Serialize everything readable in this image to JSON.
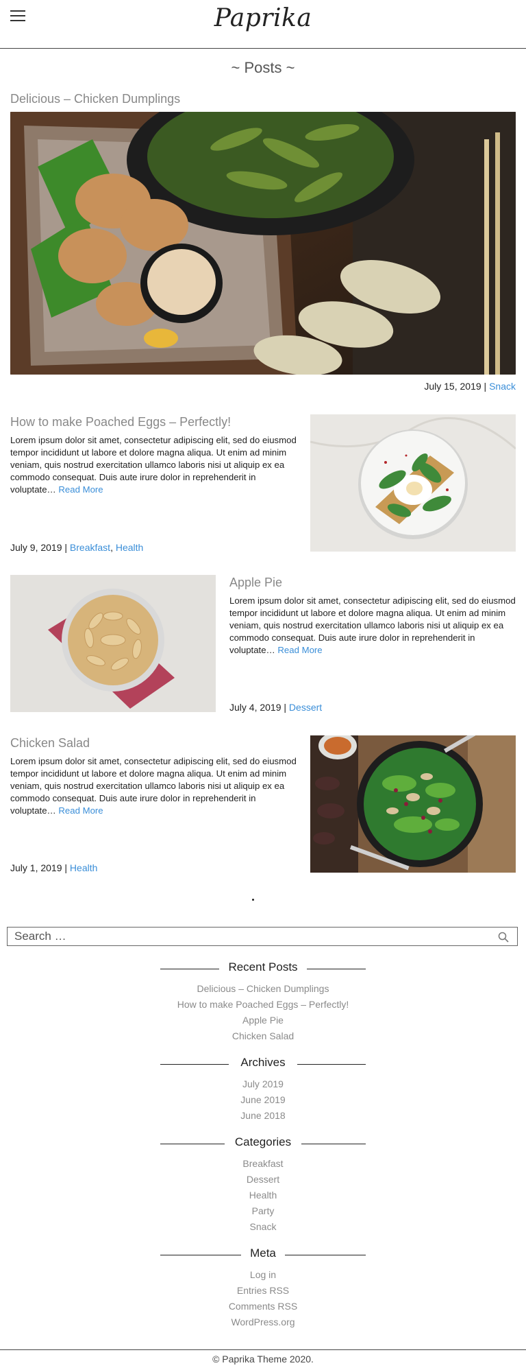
{
  "site": {
    "title": "Paprika"
  },
  "page": {
    "heading": "~ Posts ~"
  },
  "posts": [
    {
      "title": "Delicious – Chicken Dumplings",
      "date": "July 15, 2019",
      "categories": [
        "Snack"
      ]
    },
    {
      "title": "How to make Poached Eggs – Perfectly!",
      "excerpt": "Lorem ipsum dolor sit amet, consectetur adipiscing elit, sed do eiusmod tempor incididunt ut labore et dolore magna aliqua. Ut enim ad minim veniam, quis nostrud exercitation ullamco laboris nisi ut aliquip ex ea commodo consequat. Duis aute irure dolor in reprehenderit in voluptate…",
      "read_more": "Read More",
      "date": "July 9, 2019",
      "categories": [
        "Breakfast",
        "Health"
      ]
    },
    {
      "title": "Apple Pie",
      "excerpt": "Lorem ipsum dolor sit amet, consectetur adipiscing elit, sed do eiusmod tempor incididunt ut labore et dolore magna aliqua. Ut enim ad minim veniam, quis nostrud exercitation ullamco laboris nisi ut aliquip ex ea commodo consequat. Duis aute irure dolor in reprehenderit in voluptate…",
      "read_more": "Read More",
      "date": "July 4, 2019",
      "categories": [
        "Dessert"
      ]
    },
    {
      "title": "Chicken Salad",
      "excerpt": "Lorem ipsum dolor sit amet, consectetur adipiscing elit, sed do eiusmod tempor incididunt ut labore et dolore magna aliqua. Ut enim ad minim veniam, quis nostrud exercitation ullamco laboris nisi ut aliquip ex ea commodo consequat. Duis aute irure dolor in reprehenderit in voluptate…",
      "read_more": "Read More",
      "date": "July 1, 2019",
      "categories": [
        "Health"
      ]
    }
  ],
  "meta_separator": " | ",
  "category_separator": ", ",
  "search": {
    "placeholder": "Search …"
  },
  "sidebar": {
    "recent_posts": {
      "title": "Recent Posts",
      "items": [
        "Delicious – Chicken Dumplings",
        "How to make Poached Eggs – Perfectly!",
        "Apple Pie",
        "Chicken Salad"
      ]
    },
    "archives": {
      "title": "Archives",
      "items": [
        "July 2019",
        "June 2019",
        "June 2018"
      ]
    },
    "categories": {
      "title": "Categories",
      "items": [
        "Breakfast",
        "Dessert",
        "Health",
        "Party",
        "Snack"
      ]
    },
    "meta": {
      "title": "Meta",
      "items": [
        "Log in",
        "Entries RSS",
        "Comments RSS",
        "WordPress.org"
      ]
    }
  },
  "footer": {
    "text": "© Paprika Theme 2020."
  },
  "colors": {
    "link": "#3a8ed8",
    "muted_link": "#8a8a8a",
    "title": "#888888"
  },
  "icons": {
    "menu": "hamburger-icon",
    "search": "search-icon"
  }
}
